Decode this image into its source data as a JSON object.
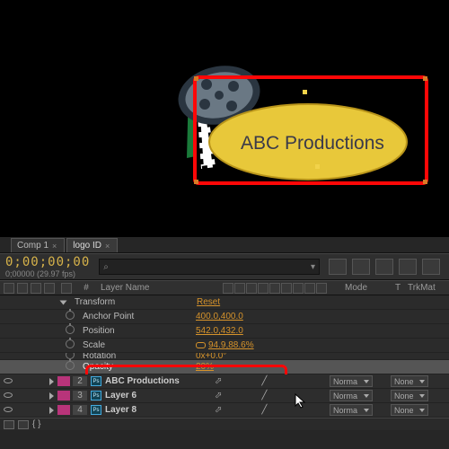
{
  "preview": {
    "logo_text": "ABC Productions"
  },
  "tabs": [
    "Comp 1",
    "logo ID"
  ],
  "timecode": {
    "value": "0;00;00;00",
    "fps": "0;00000 (29.97 fps)"
  },
  "search": {
    "placeholder": ""
  },
  "headers": {
    "pound": "#",
    "layer_name": "Layer Name",
    "mode": "Mode",
    "t": "T",
    "trkmat": "TrkMat"
  },
  "transform": {
    "label": "Transform",
    "reset": "Reset",
    "props": [
      {
        "name": "Anchor Point",
        "value": "400.0,400.0"
      },
      {
        "name": "Position",
        "value": "542.0,432.0"
      },
      {
        "name": "Scale",
        "value": "94.9,88.6%",
        "link": true
      },
      {
        "name": "Rotation",
        "value": "0x+0.0°"
      },
      {
        "name": "Opacity",
        "value": "20%",
        "selected": true
      }
    ]
  },
  "layers": [
    {
      "idx": "2",
      "name": "ABC Productions",
      "mode": "Norma",
      "trk": "None"
    },
    {
      "idx": "3",
      "name": "Layer 6",
      "mode": "Norma",
      "trk": "None"
    },
    {
      "idx": "4",
      "name": "Layer 8",
      "mode": "Norma",
      "trk": "None"
    }
  ],
  "icons": {
    "search": "⌕",
    "down": "▾"
  }
}
